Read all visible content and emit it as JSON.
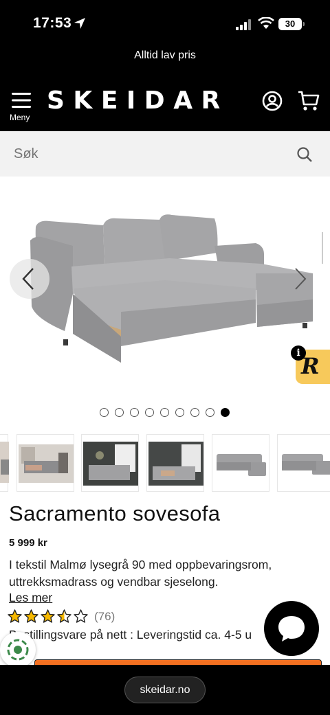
{
  "status_bar": {
    "time": "17:53",
    "battery": "30"
  },
  "promo": {
    "text": "Alltid lav pris"
  },
  "header": {
    "menu_label": "Meny",
    "logo": "SKEIDAR"
  },
  "search": {
    "placeholder": "Søk"
  },
  "gallery": {
    "dot_count": 9,
    "active_index": 8,
    "badge_letter": "R",
    "badge_info": "i"
  },
  "product": {
    "title": "Sacramento sovesofa",
    "price": "5 999 kr",
    "description": "I tekstil Malmø lysegrå 90 med oppbevaringsrom, uttrekksmadrass og vendbar sjeselong.",
    "read_more": "Les mer",
    "rating": 3.5,
    "rating_count": "(76)",
    "delivery": "Bestillingsvare på nett : Leveringstid ca. 4-5 u"
  },
  "browser": {
    "url": "skeidar.no"
  },
  "colors": {
    "accent": "#f37021",
    "star": "#f5b800",
    "badge": "#f7c95b"
  }
}
